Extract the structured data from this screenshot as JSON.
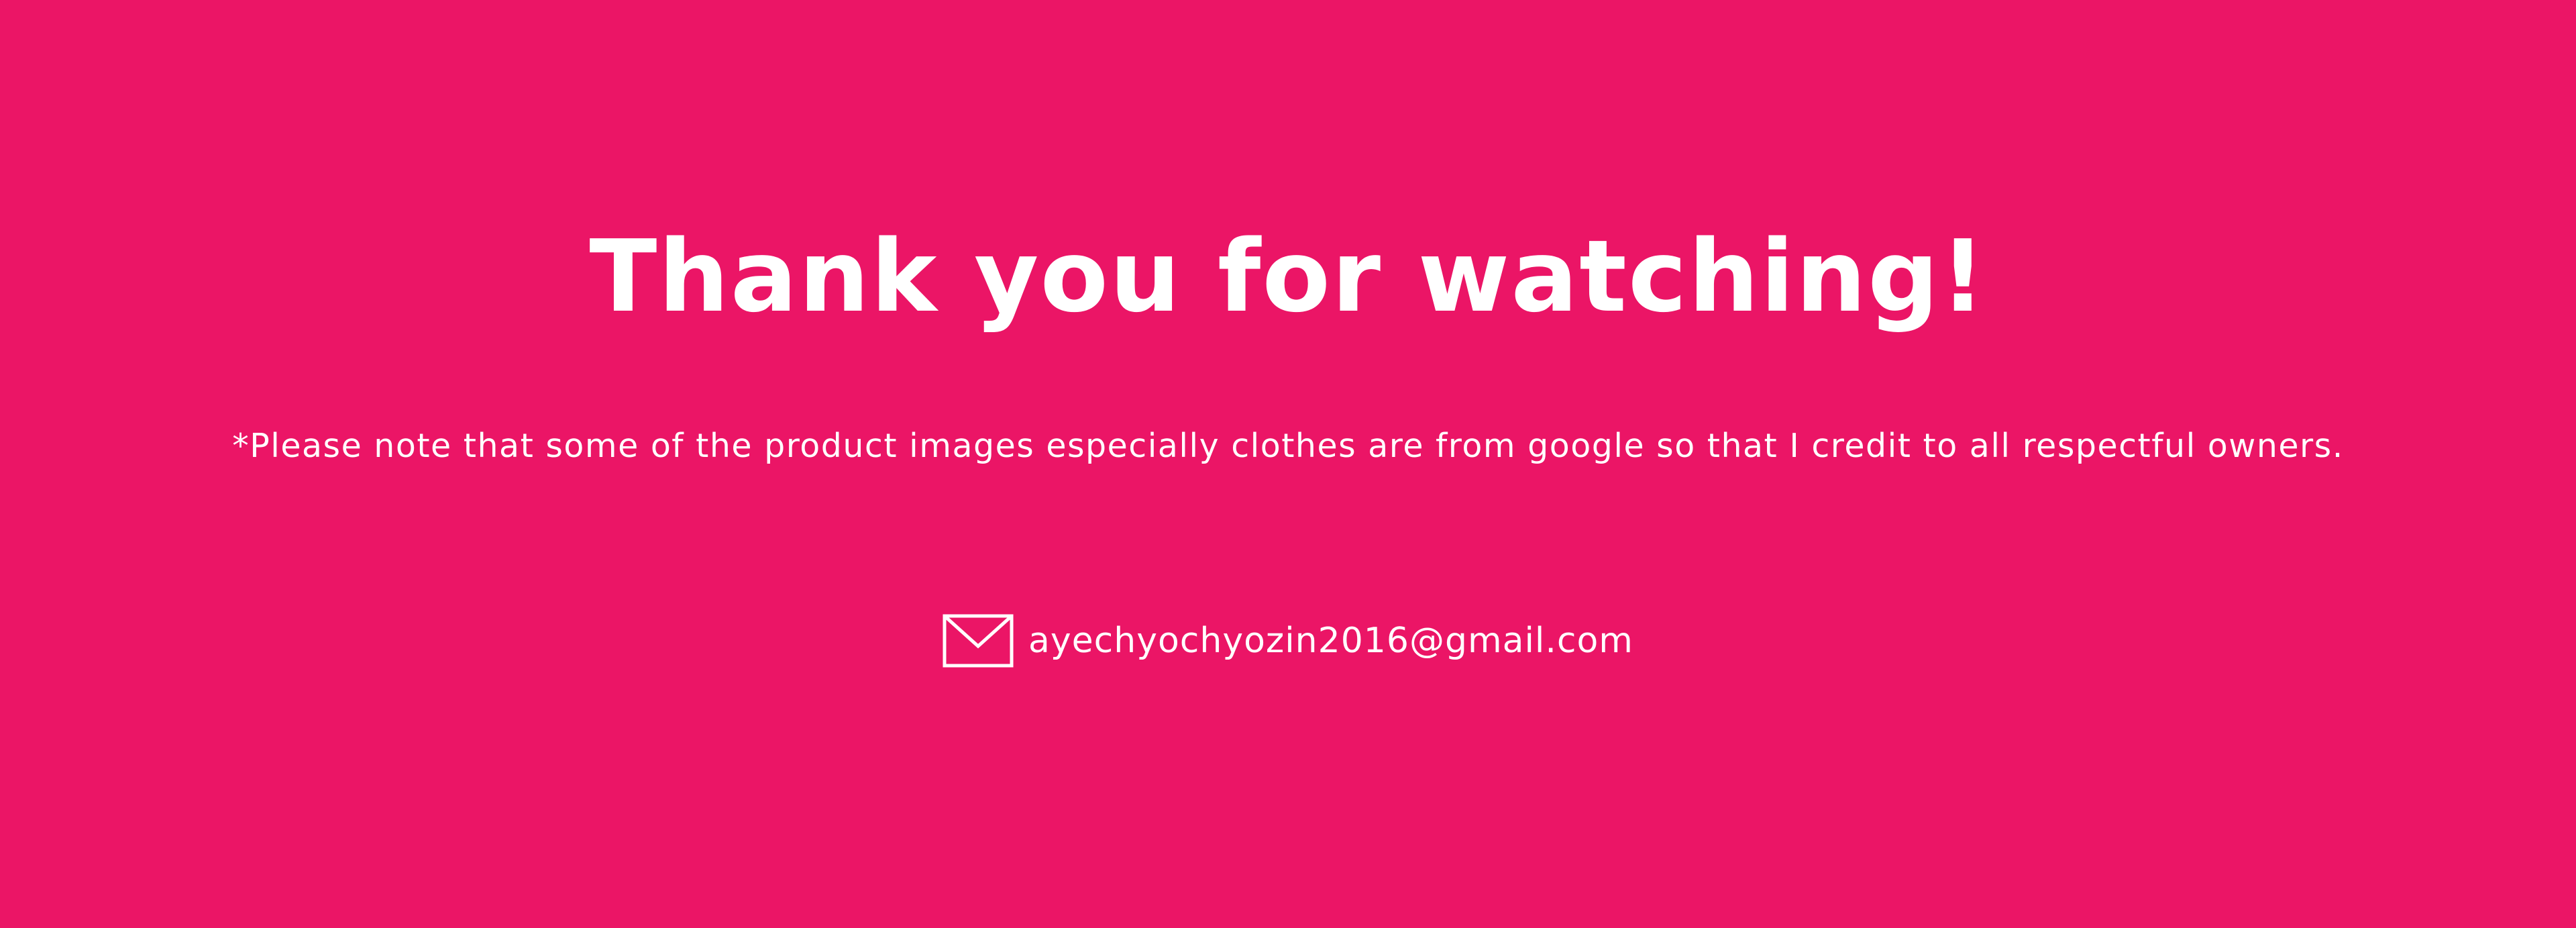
{
  "slide": {
    "background_color": "#EB1566",
    "text_color": "#FFFFFF",
    "headline": "Thank you for watching!",
    "note": "*Please note that some of the product images especially clothes are from google so that I credit to all respectful owners.",
    "contact": {
      "icon": "envelope-icon",
      "email": "ayechyochyozin2016@gmail.com"
    }
  }
}
